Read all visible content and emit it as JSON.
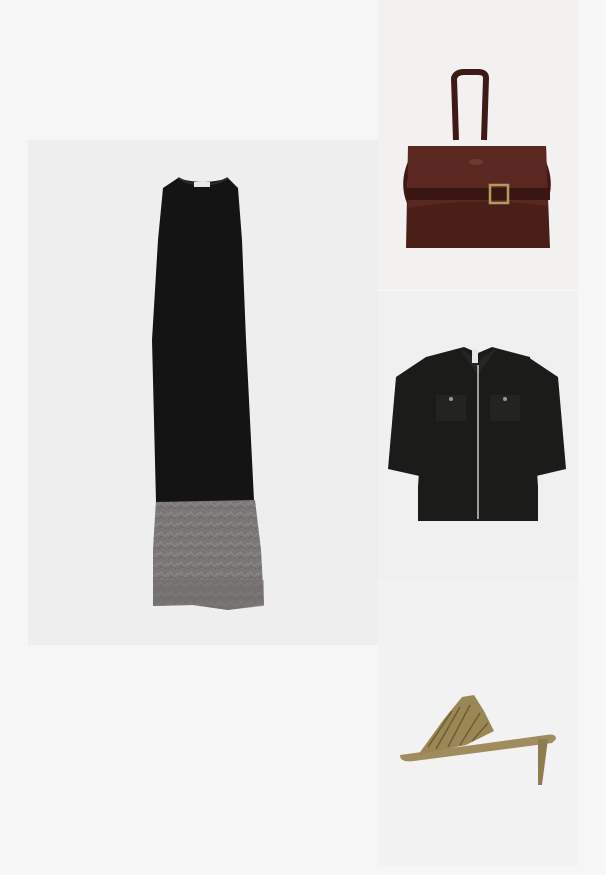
{
  "products": [
    {
      "id": "dress",
      "category": "layered-sleeveless-dress",
      "colors": {
        "top": "#141414",
        "skirt": "#7b7777"
      }
    },
    {
      "id": "bag",
      "category": "top-handle-shoulder-bag",
      "colors": {
        "body": "#4a1f18"
      }
    },
    {
      "id": "shirt",
      "category": "short-sleeve-zip-shirt",
      "colors": {
        "body": "#1b1b19"
      }
    },
    {
      "id": "shoe",
      "category": "heeled-mule-sandal",
      "colors": {
        "body": "#9a8756"
      }
    }
  ]
}
